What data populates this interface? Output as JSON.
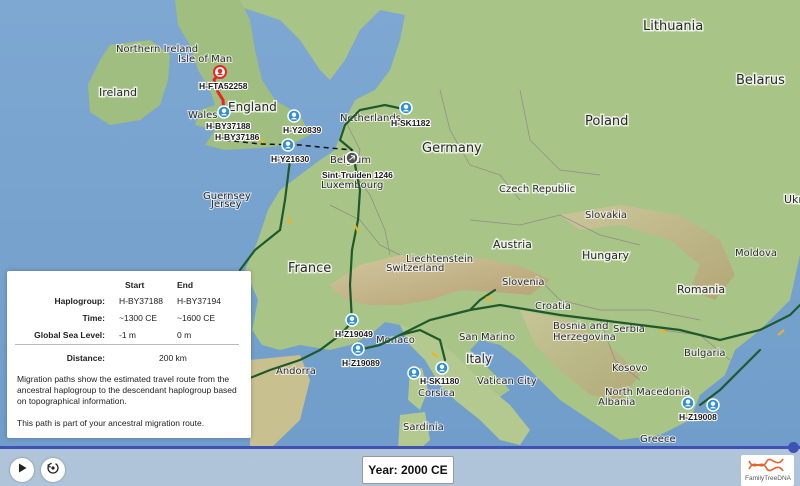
{
  "map": {
    "countries": [
      "Lithuania",
      "Belarus",
      "Poland",
      "Germany",
      "Netherlands",
      "Belgium",
      "Luxembourg",
      "Czech Republic",
      "Slovakia",
      "Hungary",
      "Austria",
      "Liechtenstein",
      "Switzerland",
      "France",
      "Slovenia",
      "Croatia",
      "Bosnia and Herzegovina",
      "Serbia",
      "Romania",
      "Moldova",
      "Bulgaria",
      "Kosovo",
      "North Macedonia",
      "Albania",
      "Greece",
      "Italy",
      "San Marino",
      "Vatican City",
      "Monaco",
      "Andorra",
      "Northern Ireland",
      "Isle of Man",
      "Ireland",
      "England",
      "Wales",
      "Guernsey",
      "Jersey",
      "Sardinia",
      "Corsica",
      "Ukr"
    ],
    "markers": [
      "H-FTA52258",
      "H-BY37188",
      "H-BY37186",
      "H-Y20839",
      "H-Y21630",
      "H-SK1182",
      "Sint-Truiden 1246",
      "H-Z19049",
      "H-Z19089",
      "H-SK1180",
      "H-Z19008"
    ]
  },
  "info_panel": {
    "start_header": "Start",
    "end_header": "End",
    "haplogroup_label": "Haplogroup:",
    "haplogroup_start": "H-BY37188",
    "haplogroup_end": "H-BY37194",
    "time_label": "Time:",
    "time_start": "~1300 CE",
    "time_end": "~1600 CE",
    "sea_label": "Global Sea Level:",
    "sea_start": "-1 m",
    "sea_end": "0 m",
    "distance_label": "Distance:",
    "distance_value": "200 km",
    "description": "Migration paths show the estimated travel route from the ancestral haplogroup to the descendant haplogroup based on topographical information.",
    "ancestral_note": "This path is part of your ancestral migration route."
  },
  "timeline": {
    "year_label": "Year: 2000 CE",
    "progress": 1.0
  },
  "controls": {
    "play_icon": "play-icon",
    "replay_icon": "replay-icon"
  },
  "logo": {
    "brand": "FamilyTreeDNA"
  },
  "colors": {
    "route": "#1e5a2a",
    "highlight_route": "#e8262a",
    "marker": "#2f8fd8",
    "timeline": "#3f51b5"
  }
}
